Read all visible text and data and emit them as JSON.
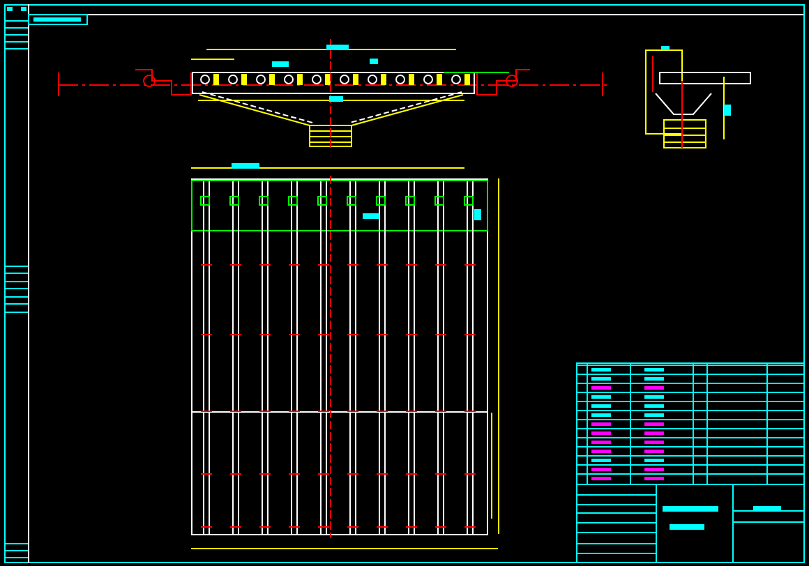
{
  "drawing": {
    "kind": "cad"
  }
}
